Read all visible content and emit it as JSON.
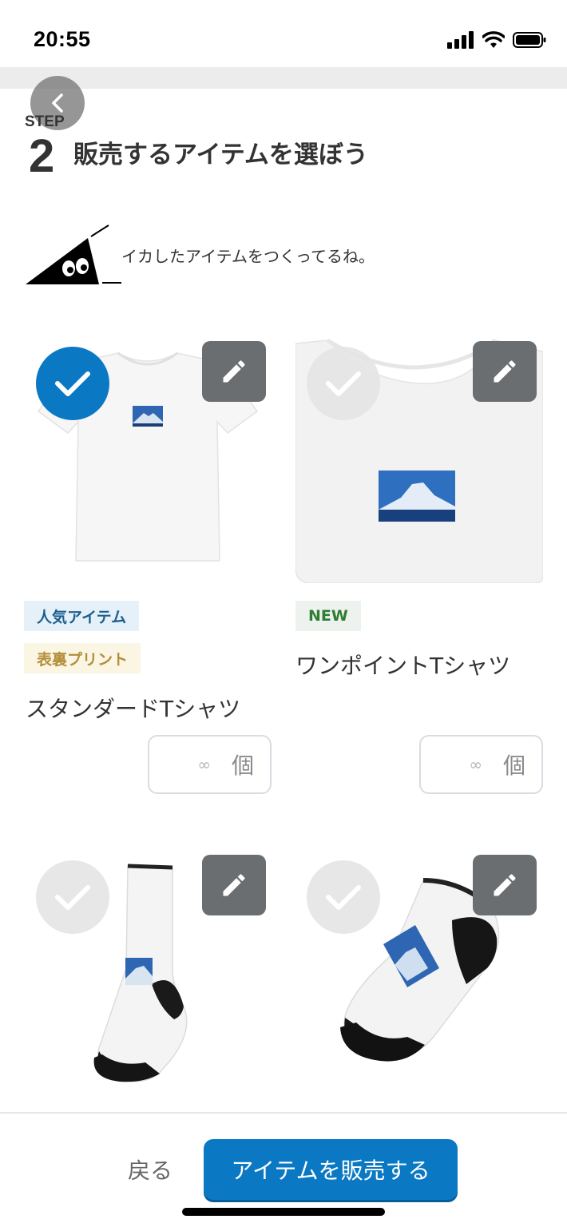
{
  "status_bar": {
    "time": "20:55"
  },
  "header": {
    "step_label": "STEP",
    "step_number": "2",
    "title": "販売するアイテムを選ぼう"
  },
  "mascot": {
    "message": "イカしたアイテムをつくってるね。"
  },
  "products": [
    {
      "name": "スタンダードTシャツ",
      "selected": true,
      "tags": [
        "人気アイテム",
        "表裏プリント"
      ],
      "quantity": "∞",
      "unit": "個"
    },
    {
      "name": "ワンポイントTシャツ",
      "selected": false,
      "tags": [
        "NEW"
      ],
      "quantity": "∞",
      "unit": "個"
    },
    {
      "name": "",
      "selected": false,
      "tags": [],
      "image": "crew-socks"
    },
    {
      "name": "",
      "selected": false,
      "tags": [],
      "image": "ankle-socks"
    }
  ],
  "footer": {
    "back_label": "戻る",
    "sell_label": "アイテムを販売する"
  },
  "colors": {
    "accent": "#0b78c4",
    "edit_button": "#6a6e71",
    "popular_tag_bg": "#e5f0f9",
    "new_tag_text": "#2e7d32"
  }
}
